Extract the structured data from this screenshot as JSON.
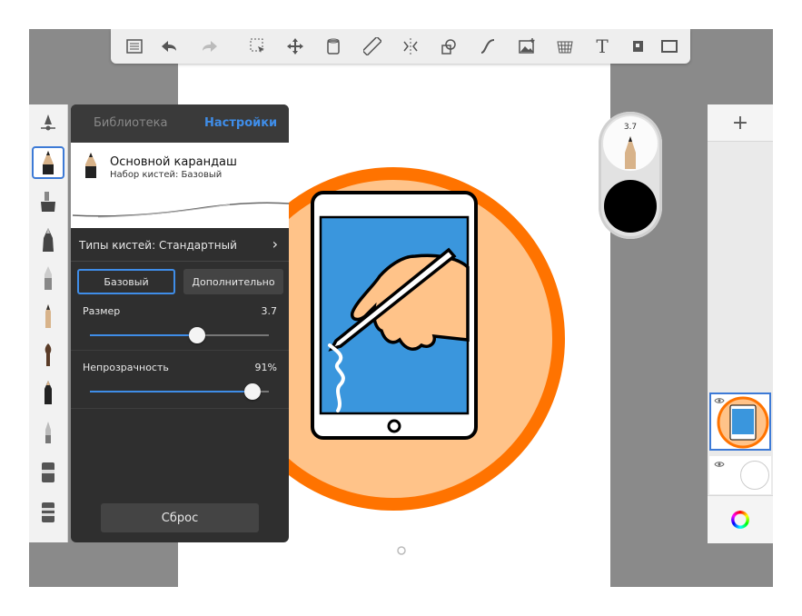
{
  "toolbar": {
    "icons": [
      "list-icon",
      "undo-icon",
      "redo-icon",
      "select-icon",
      "move-icon",
      "bucket-icon",
      "ruler-icon",
      "symmetry-icon",
      "shapes-icon",
      "curve-icon",
      "image-icon",
      "perspective-icon",
      "text-icon",
      "canvas-size-icon",
      "fullscreen-icon"
    ],
    "text_glyph": "T"
  },
  "brush_panel": {
    "tab_library": "Библиотека",
    "tab_settings": "Настройки",
    "active_tab": "Настройки",
    "brush_name": "Основной карандаш",
    "brush_set": "Набор кистей: Базовый",
    "brush_type": "Типы кистей: Стандартный",
    "brush_type_arrow": "›",
    "seg_basic": "Базовый",
    "seg_advanced": "Дополнительно",
    "size_label": "Размер",
    "size_value": "3.7",
    "size_fraction": 0.6,
    "opacity_label": "Непрозрачность",
    "opacity_value": "91%",
    "opacity_fraction": 0.91,
    "reset_label": "Сброс"
  },
  "color_puck": {
    "size_value": "3.7",
    "current_color": "#000000"
  },
  "layers_panel": {
    "add_label": "+"
  },
  "colors": {
    "accent": "#3f8de8",
    "orange": "#ff7300",
    "peach": "#ffc389",
    "screen_blue": "#3a96dd",
    "panel_bg": "#2f2f2f"
  }
}
